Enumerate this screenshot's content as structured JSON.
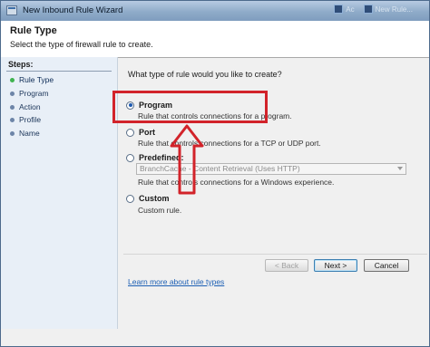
{
  "window": {
    "title": "New Inbound Rule Wizard"
  },
  "background_peek": [
    {
      "label": "Ac"
    },
    {
      "label": "New Rule..."
    }
  ],
  "header": {
    "title": "Rule Type",
    "subtitle": "Select the type of firewall rule to create."
  },
  "sidebar": {
    "heading": "Steps:",
    "items": [
      {
        "label": "Rule Type",
        "active": true
      },
      {
        "label": "Program",
        "active": false
      },
      {
        "label": "Action",
        "active": false
      },
      {
        "label": "Profile",
        "active": false
      },
      {
        "label": "Name",
        "active": false
      }
    ]
  },
  "main": {
    "question": "What type of rule would you like to create?",
    "options": [
      {
        "label": "Program",
        "description": "Rule that controls connections for a program.",
        "selected": true
      },
      {
        "label": "Port",
        "description": "Rule that controls connections for a TCP or UDP port.",
        "selected": false
      },
      {
        "label": "Predefined:",
        "description": "Rule that controls connections for a Windows experience.",
        "selected": false,
        "select_value": "BranchCache - Content Retrieval (Uses HTTP)"
      },
      {
        "label": "Custom",
        "description": "Custom rule.",
        "selected": false
      }
    ],
    "learn_more": "Learn more about rule types"
  },
  "buttons": {
    "back": "< Back",
    "next": "Next >",
    "cancel": "Cancel"
  },
  "colors": {
    "highlight": "#d2232a",
    "link": "#1c5fb4",
    "active_step": "#3fb34f"
  }
}
